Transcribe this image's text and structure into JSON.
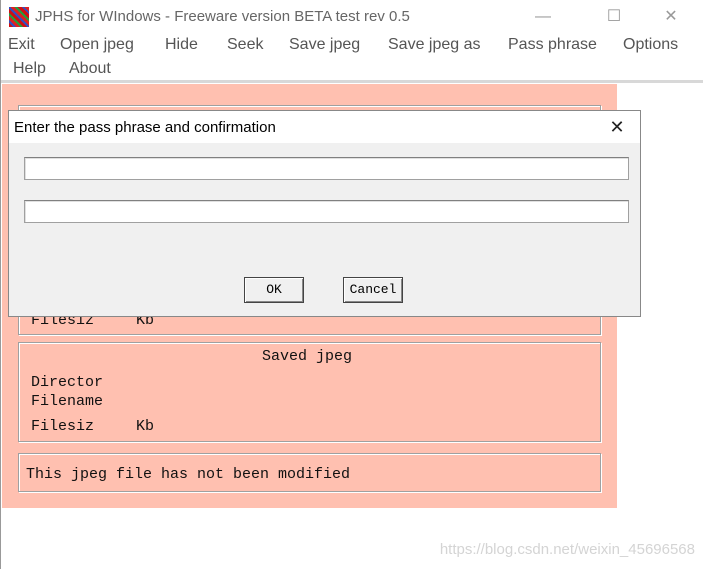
{
  "window": {
    "title": "JPHS for WIndows - Freeware version BETA test rev 0.5",
    "controls": {
      "minimize": "—",
      "maximize": "☐",
      "close": "✕"
    }
  },
  "menu": [
    "Exit",
    "Open jpeg",
    "Hide",
    "Seek",
    "Save jpeg",
    "Save jpeg as",
    "Pass phrase",
    "Options",
    "Help",
    "About"
  ],
  "input_panel": {
    "filesize_label": "Filesiz",
    "filesize_unit": "Kb"
  },
  "saved_panel": {
    "heading": "Saved jpeg",
    "directory_label": "Director",
    "filename_label": "Filename",
    "filesize_label": "Filesiz",
    "filesize_unit": "Kb"
  },
  "status": "This jpeg file has not been modified",
  "dialog": {
    "title": "Enter the pass phrase and confirmation",
    "close": "✕",
    "pass_phrase": "",
    "confirmation": "",
    "ok_label": "OK",
    "cancel_label": "Cancel"
  },
  "watermark": "https://blog.csdn.net/weixin_45696568",
  "colors": {
    "client_bg": "#ffc0b0",
    "dialog_bg": "#f0f0f0"
  }
}
